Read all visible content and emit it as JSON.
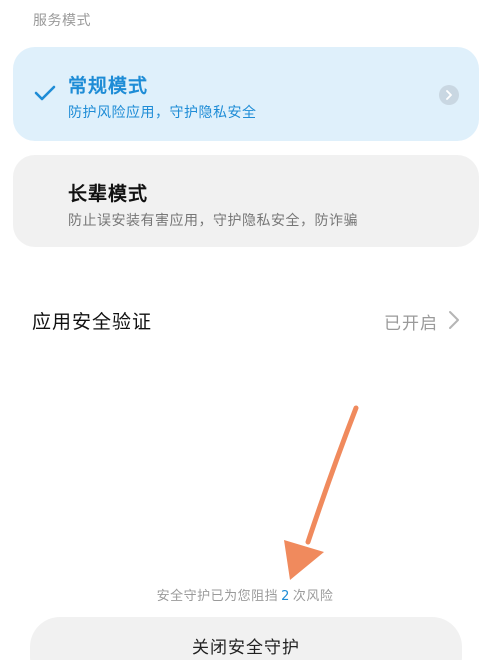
{
  "section": {
    "title": "服务模式"
  },
  "modes": [
    {
      "title": "常规模式",
      "description": "防护风险应用，守护隐私安全",
      "selected": true
    },
    {
      "title": "长辈模式",
      "description": "防止误安装有害应用，守护隐私安全，防诈骗",
      "selected": false
    }
  ],
  "app_verification": {
    "label": "应用安全验证",
    "status": "已开启"
  },
  "blocked": {
    "prefix": "安全守护已为您阻挡",
    "count": "2",
    "suffix": "次风险"
  },
  "close_button": {
    "label": "关闭安全守护"
  },
  "colors": {
    "accent": "#1e8cd6",
    "selected_bg": "#dff0fb",
    "card_bg": "#f1f1f1",
    "annotation_arrow": "#f08a5d"
  },
  "icons": {
    "selected_mark": "check-icon",
    "mode_detail": "chevron-right-icon",
    "row_detail": "chevron-right-icon",
    "annotation": "arrow-annotation"
  }
}
